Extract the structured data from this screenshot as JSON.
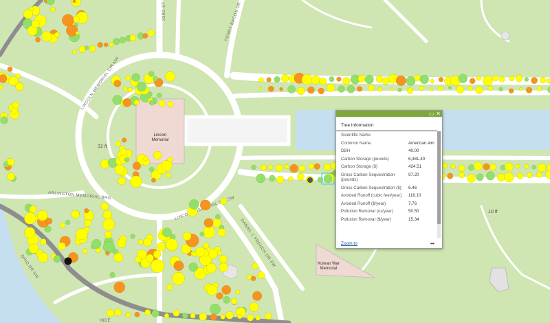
{
  "map": {
    "labels": {
      "lincoln_memorial": "Lincoln\nMemorial",
      "korean_war_memorial": "Korean War\nMemorial",
      "lincoln_memorial_cir_nw": "LINCOLN MEMORIAL CIR NW",
      "lincoln_memorial_cir_sw": "LINCOLN MEMORIAL CIR SW",
      "arlington_memorial_brg": "ARLINGTON MEMORIAL BRG",
      "daniel_c_french_dr_sw": "DANIEL C FRENCH DR SW",
      "henry_bacon_dr": "HENRY BACON DR",
      "street_23rd": "23RD ST",
      "ohio_dr_sw": "OHIO DR SW",
      "ind_partial": "INDE",
      "elev_31": "31 ft",
      "elev_10": "10 ft"
    },
    "colors": {
      "grass": "#cfe5b2",
      "road": "#ffffff",
      "highway": "#8e8e8e",
      "water": "#c6dff0",
      "building": "#f0d9d2",
      "tree_yellow": "#ffff00",
      "tree_orange": "#f7931e",
      "tree_green": "#91e06a",
      "tree_dark": "#111111"
    }
  },
  "popup": {
    "title": "Tree Information",
    "maximize_icon": "maximize-icon",
    "close_icon": "close-icon",
    "rows": [
      {
        "label": "Scientific Name",
        "value": ""
      },
      {
        "label": "Common Name",
        "value": "American elm"
      },
      {
        "label": "DBH",
        "value": "40.00"
      },
      {
        "label": "Carbon Storage (pounds)",
        "value": "6,381.40"
      },
      {
        "label": "Carbon Storage ($)",
        "value": "424.51"
      },
      {
        "label": "Gross Carbon Sequestration (pounds)",
        "value": "97.20"
      },
      {
        "label": "Gross Carbon Sequestration ($)",
        "value": "6.46"
      },
      {
        "label": "Avoided Runoff (cubic feet/year)",
        "value": "116.10"
      },
      {
        "label": "Avoided Runoff ($/year)",
        "value": "7.76"
      },
      {
        "label": "Pollution Removal (oz/year)",
        "value": "50.50"
      },
      {
        "label": "Pollution Removal ($/year)",
        "value": "15.34"
      }
    ],
    "zoom_link": "Zoom to",
    "more_icon": "more-options-icon"
  }
}
